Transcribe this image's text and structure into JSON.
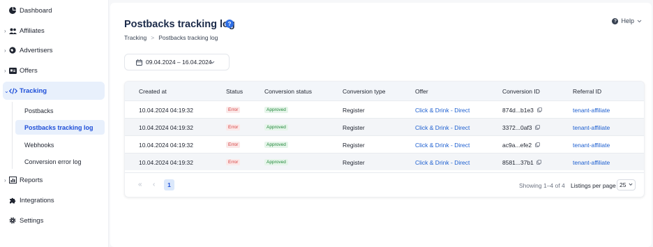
{
  "sidebar": {
    "items": [
      {
        "label": "Dashboard",
        "icon": "pie-chart-icon",
        "has_chevron": false
      },
      {
        "label": "Affiliates",
        "icon": "users-icon",
        "has_chevron": true
      },
      {
        "label": "Advertisers",
        "icon": "globe-icon",
        "has_chevron": true
      },
      {
        "label": "Offers",
        "icon": "offer-card-icon",
        "has_chevron": true
      },
      {
        "label": "Tracking",
        "icon": "code-icon",
        "has_chevron": true,
        "active": true
      },
      {
        "label": "Reports",
        "icon": "report-icon",
        "has_chevron": true
      },
      {
        "label": "Integrations",
        "icon": "puzzle-icon",
        "has_chevron": false
      },
      {
        "label": "Settings",
        "icon": "gear-icon",
        "has_chevron": false
      }
    ],
    "tracking_sub": [
      {
        "label": "Postbacks"
      },
      {
        "label": "Postbacks tracking log",
        "active": true
      },
      {
        "label": "Webhooks"
      },
      {
        "label": "Conversion error log"
      }
    ]
  },
  "header": {
    "title": "Postbacks tracking log",
    "help_badge": "?",
    "breadcrumb": [
      "Tracking",
      "Postbacks tracking log"
    ],
    "breadcrumb_sep": ">",
    "help_label": "Help"
  },
  "filters": {
    "date_range": "09.04.2024 – 16.04.2024"
  },
  "table": {
    "columns": [
      "Created at",
      "Status",
      "Conversion status",
      "Conversion type",
      "Offer",
      "Conversion ID",
      "Referral ID"
    ],
    "rows": [
      {
        "created_at": "10.04.2024 04:19:32",
        "status": "Error",
        "conversion_status": "Approved",
        "conversion_type": "Register",
        "offer": "Click & Drink - Direct",
        "conversion_id": "874d...b1e3",
        "referral_id": "tenant-affiliate"
      },
      {
        "created_at": "10.04.2024 04:19:32",
        "status": "Error",
        "conversion_status": "Approved",
        "conversion_type": "Register",
        "offer": "Click & Drink - Direct",
        "conversion_id": "3372...0af3",
        "referral_id": "tenant-affiliate"
      },
      {
        "created_at": "10.04.2024 04:19:32",
        "status": "Error",
        "conversion_status": "Approved",
        "conversion_type": "Register",
        "offer": "Click & Drink - Direct",
        "conversion_id": "ac9a...efe2",
        "referral_id": "tenant-affiliate"
      },
      {
        "created_at": "10.04.2024 04:19:32",
        "status": "Error",
        "conversion_status": "Approved",
        "conversion_type": "Register",
        "offer": "Click & Drink - Direct",
        "conversion_id": "8581...37b1",
        "referral_id": "tenant-affiliate"
      }
    ]
  },
  "pagination": {
    "first": "«",
    "prev": "‹",
    "current_page": "1",
    "showing": "Showing 1–4 of 4",
    "listings_label": "Listings per page",
    "per_page": "25"
  },
  "colors": {
    "accent": "#1d4ed8",
    "link": "#1d5fd0",
    "error": "#d43c3c",
    "approved": "#22883b",
    "active_bg": "#e8f0fc"
  }
}
